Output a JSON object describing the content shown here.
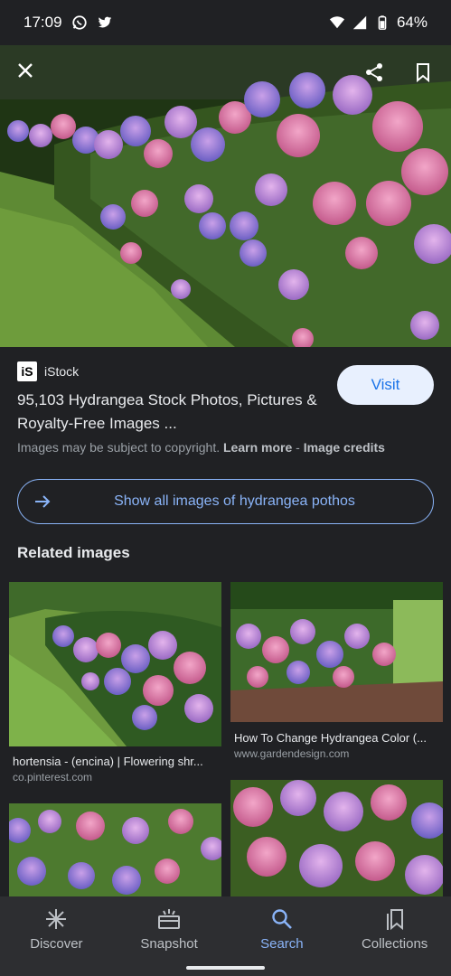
{
  "status_bar": {
    "time": "17:09",
    "battery": "64%",
    "icons": [
      "whatsapp-icon",
      "twitter-icon",
      "wifi-icon",
      "signal-icon",
      "battery-icon"
    ]
  },
  "hero": {
    "icons": [
      "close-icon",
      "share-icon",
      "bookmark-icon"
    ]
  },
  "result": {
    "source_logo": "iS",
    "source_name": "iStock",
    "title": "95,103 Hydrangea Stock Photos, Pictures & Royalty-Free Images ...",
    "visit_label": "Visit",
    "copyright_text": "Images may be subject to copyright.",
    "learn_more": "Learn more",
    "separator": "-",
    "image_credits": "Image credits"
  },
  "show_all": {
    "label": "Show all images of hydrangea pothos"
  },
  "related": {
    "heading": "Related images",
    "items": [
      {
        "caption": "hortensia - (encina) | Flowering shr...",
        "source": "co.pinterest.com"
      },
      {
        "caption": "How To Change Hydrangea Color (...",
        "source": "www.gardendesign.com"
      }
    ]
  },
  "bottom_nav": {
    "items": [
      {
        "label": "Discover",
        "icon": "asterisk-icon"
      },
      {
        "label": "Snapshot",
        "icon": "snapshot-icon"
      },
      {
        "label": "Search",
        "icon": "search-icon",
        "active": true
      },
      {
        "label": "Collections",
        "icon": "collections-icon"
      }
    ]
  },
  "colors": {
    "background": "#202124",
    "accent": "#8ab4f8",
    "visit_button_bg": "#e8f0fe",
    "nav_bg": "#2d2e31"
  }
}
